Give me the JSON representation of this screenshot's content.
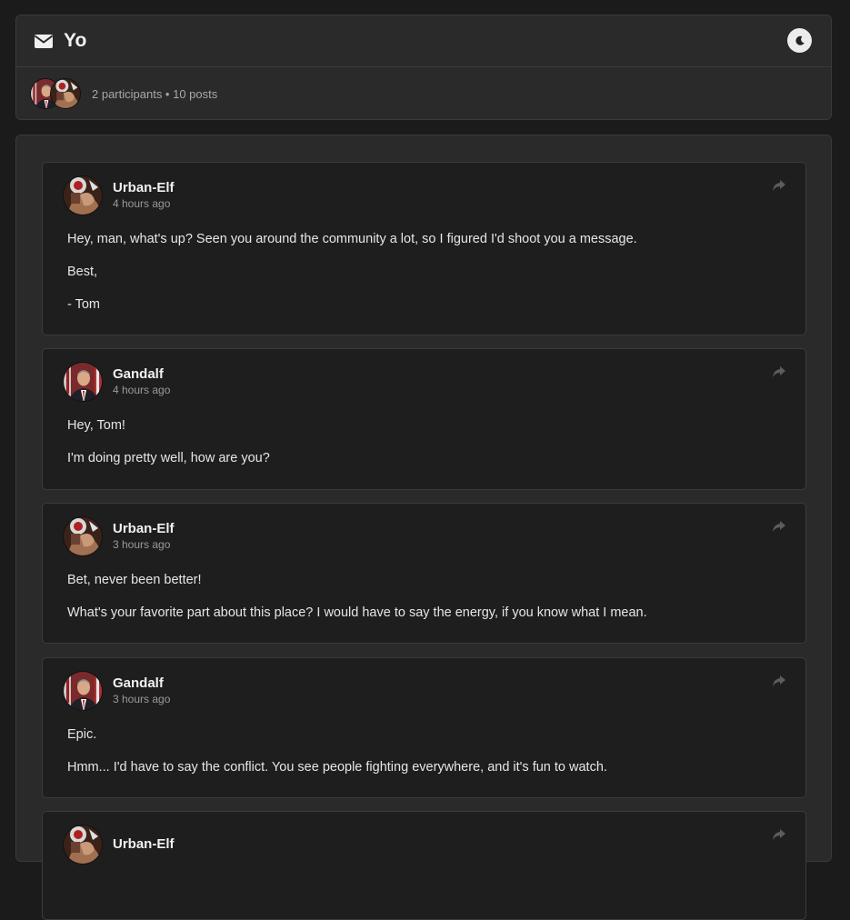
{
  "conversation": {
    "title": "Yo",
    "meta": "2 participants • 10 posts",
    "icons": {
      "title": "envelope-icon",
      "theme": "moon-icon",
      "share": "share-icon"
    }
  },
  "posts": [
    {
      "author": "Urban-Elf",
      "time": "4 hours ago",
      "lines": [
        "Hey, man, what's up?  Seen you around the community a lot, so I figured I'd shoot you a message.",
        "Best,",
        "- Tom"
      ]
    },
    {
      "author": "Gandalf",
      "time": "4 hours ago",
      "lines": [
        "Hey, Tom!",
        "I'm doing pretty well, how are you?"
      ]
    },
    {
      "author": "Urban-Elf",
      "time": "3 hours ago",
      "lines": [
        "Bet, never been better!",
        "What's your favorite part about this place?  I would have to say the energy, if you know what I mean."
      ]
    },
    {
      "author": "Gandalf",
      "time": "3 hours ago",
      "lines": [
        "Epic.",
        "Hmm...  I'd have to say the conflict.  You see people fighting everywhere, and it's fun to watch."
      ]
    },
    {
      "author": "Urban-Elf",
      "time": "",
      "lines": []
    }
  ]
}
